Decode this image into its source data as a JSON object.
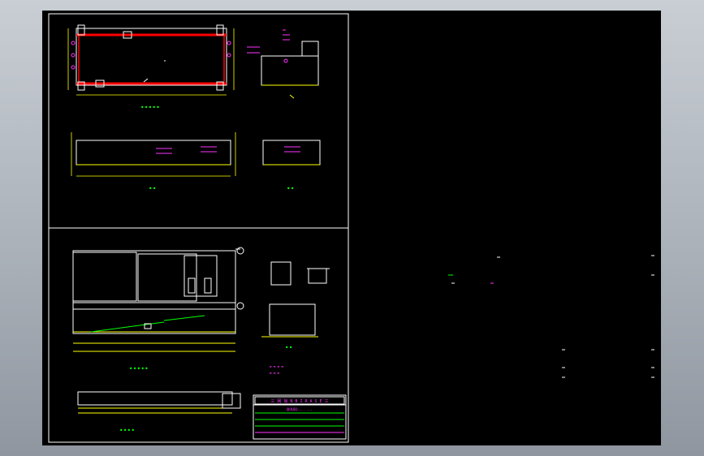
{
  "viewer": {
    "title_block": {
      "line1": "三 网 易   N B I R A S E   三",
      "line2": "联系QQ:... ..."
    }
  },
  "colors": {
    "background": "#000000",
    "frame": "#ffffff",
    "dimension": "#ffff00",
    "annotation": "#ff33ff",
    "highlight": "#ff0000",
    "leader": "#00ff00",
    "outer": "#aab1b9"
  }
}
